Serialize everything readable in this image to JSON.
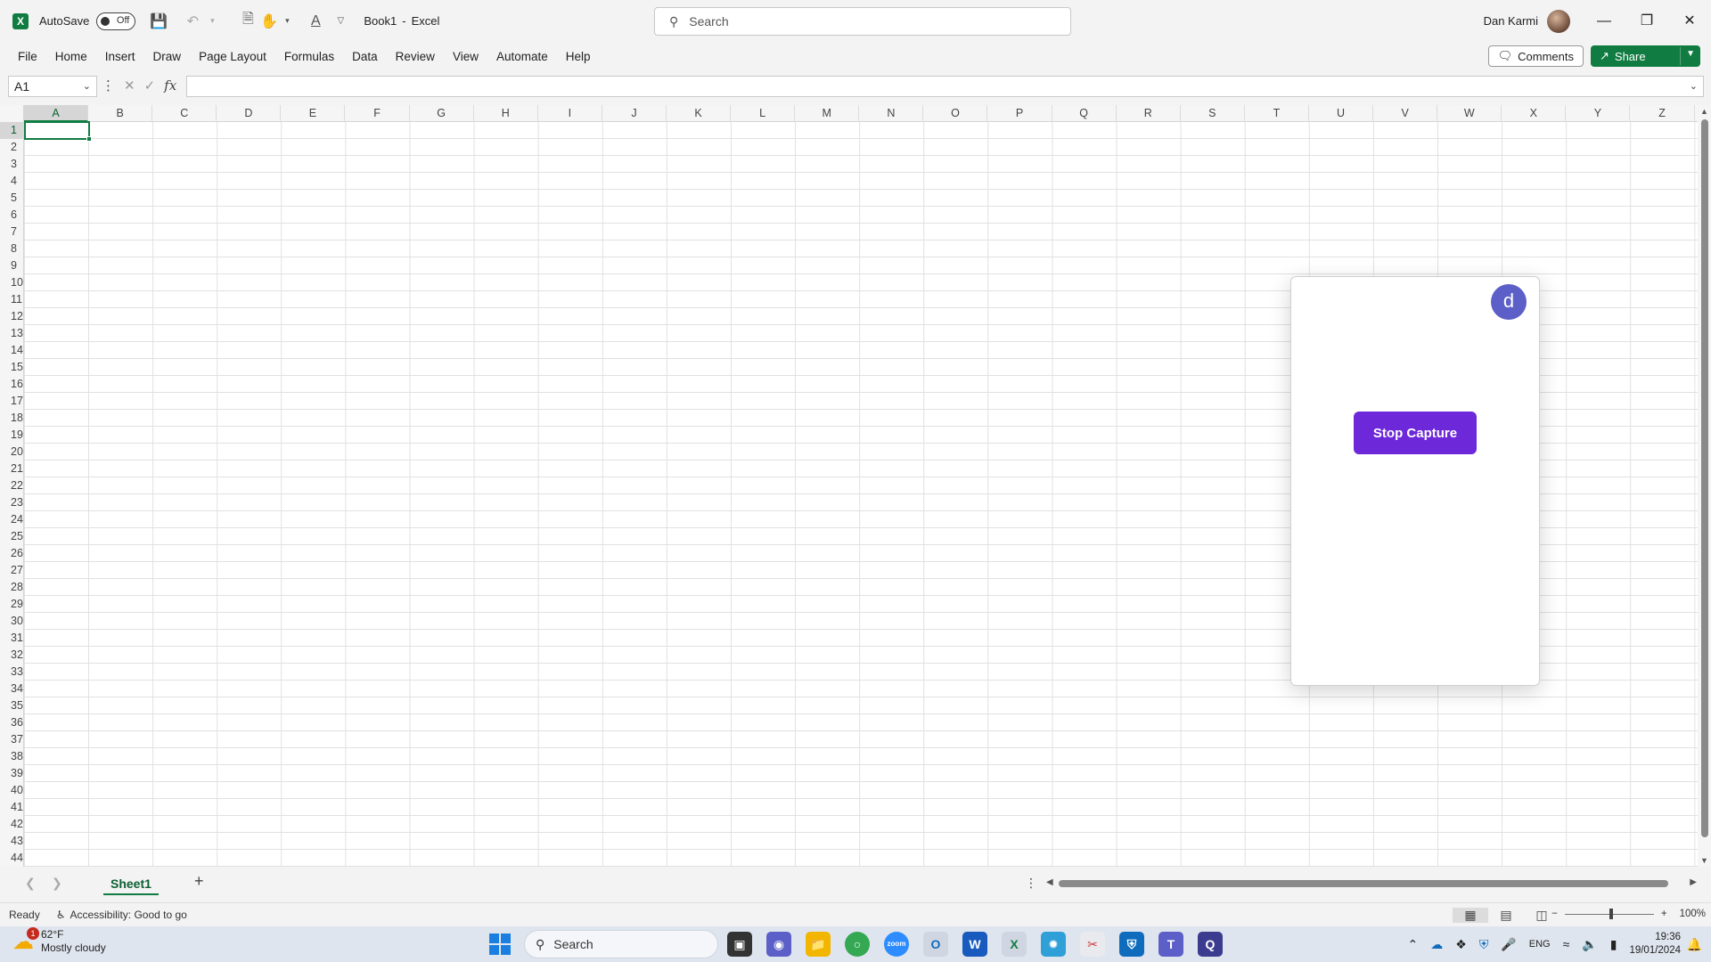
{
  "titlebar": {
    "autosave_label": "AutoSave",
    "autosave_state": "Off",
    "doc_title": "Book1",
    "app_name": "Excel",
    "search_placeholder": "Search",
    "user_name": "Dan Karmi"
  },
  "menu": {
    "items": [
      "File",
      "Home",
      "Insert",
      "Draw",
      "Page Layout",
      "Formulas",
      "Data",
      "Review",
      "View",
      "Automate",
      "Help"
    ],
    "comments_label": "Comments",
    "share_label": "Share"
  },
  "formula_bar": {
    "name_box": "A1",
    "fx_label": "fx",
    "value": ""
  },
  "grid": {
    "columns": [
      "A",
      "B",
      "C",
      "D",
      "E",
      "F",
      "G",
      "H",
      "I",
      "J",
      "K",
      "L",
      "M",
      "N",
      "O",
      "P",
      "Q",
      "R",
      "S",
      "T",
      "U",
      "V",
      "W",
      "X",
      "Y",
      "Z"
    ],
    "rows": [
      "1",
      "2",
      "3",
      "4",
      "5",
      "6",
      "7",
      "8",
      "9",
      "10",
      "11",
      "12",
      "13",
      "14",
      "15",
      "16",
      "17",
      "18",
      "19",
      "20",
      "21",
      "22",
      "23",
      "24",
      "25",
      "26",
      "27",
      "28",
      "29",
      "30",
      "31",
      "32",
      "33",
      "34",
      "35",
      "36",
      "37",
      "38",
      "39",
      "40",
      "41",
      "42",
      "43",
      "44"
    ],
    "active_cell": "A1"
  },
  "capture_panel": {
    "avatar_letter": "d",
    "stop_label": "Stop Capture",
    "button_color": "#6d28d9"
  },
  "sheets": {
    "tabs": [
      "Sheet1"
    ],
    "active": "Sheet1"
  },
  "status": {
    "ready": "Ready",
    "accessibility": "Accessibility: Good to go",
    "zoom": "100%"
  },
  "taskbar": {
    "weather_temp": "62°F",
    "weather_desc": "Mostly cloudy",
    "weather_badge": "1",
    "search_label": "Search",
    "language": "ENG",
    "time": "19:36",
    "date": "19/01/2024"
  },
  "colors": {
    "excel_green": "#107c41",
    "avatar_blue": "#5b5fc7"
  }
}
